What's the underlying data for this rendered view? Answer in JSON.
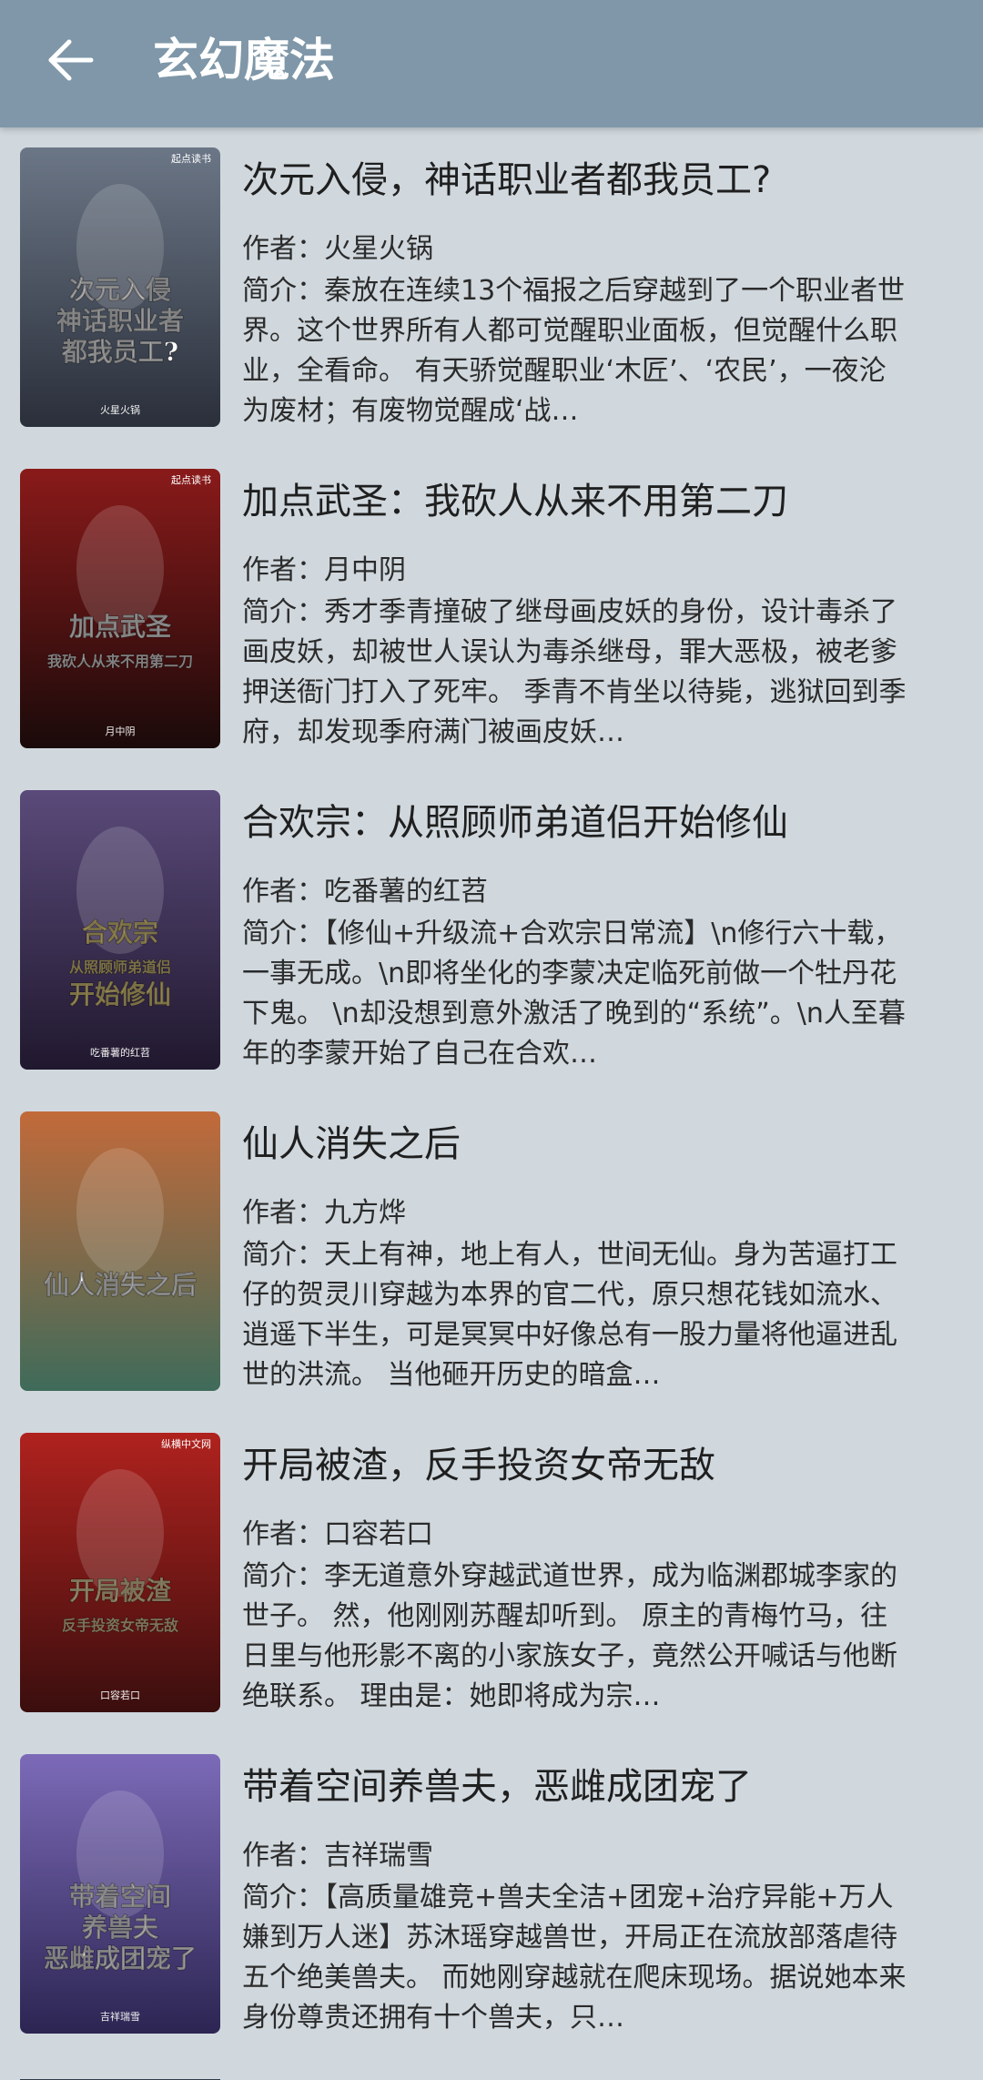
{
  "header": {
    "title": "玄幻魔法",
    "back_icon": "arrow-left-icon"
  },
  "books": [
    {
      "title": "次元入侵，神话职业者都我员工?",
      "author": "作者：火星火锅",
      "intro": "简介：秦放在连续13个福报之后穿越到了一个职业者世界。这个世界所有人都可觉醒职业面板，但觉醒什么职业，全看命。 有天骄觉醒职业‘木匠’、‘农民’，一夜沦为废材；有废物觉醒成‘战…",
      "cover": {
        "c1": "#6b7686",
        "c2": "#2a2f3a",
        "accent": "#ffffff",
        "badge": "起点读书",
        "lines": [
          "次元入侵",
          "神话职业者",
          "都我员工?"
        ],
        "author_mark": "火星火锅"
      }
    },
    {
      "title": "加点武圣：我砍人从来不用第二刀",
      "author": "作者：月中阴",
      "intro": "简介：秀才季青撞破了继母画皮妖的身份，设计毒杀了画皮妖，却被世人误认为毒杀继母，罪大恶极，被老爹押送衙门打入了死牢。 季青不肯坐以待毙，逃狱回到季府，却发现季府满门被画皮妖…",
      "cover": {
        "c1": "#8a1a1a",
        "c2": "#1a0a0a",
        "accent": "#ffffff",
        "badge": "起点读书",
        "lines": [
          "加点武圣",
          "我砍人从来不用第二刀"
        ],
        "author_mark": "月中阴"
      }
    },
    {
      "title": "合欢宗：从照顾师弟道侣开始修仙",
      "author": "作者：吃番薯的红苕",
      "intro": "简介：【修仙+升级流+合欢宗日常流】\\n修行六十载，一事无成。\\n即将坐化的李蒙决定临死前做一个牡丹花下鬼。 \\n却没想到意外激活了晚到的“系统”。\\n人至暮年的李蒙开始了自己在合欢…",
      "cover": {
        "c1": "#5a4a7a",
        "c2": "#20182e",
        "accent": "#f7e08a",
        "badge": "",
        "lines": [
          "合欢宗",
          "从照顾师弟道侣",
          "开始修仙"
        ],
        "author_mark": "吃番薯的红苕"
      }
    },
    {
      "title": "仙人消失之后",
      "author": "作者：九方烨",
      "intro": "简介：天上有神，地上有人，世间无仙。身为苦逼打工仔的贺灵川穿越为本界的官二代，原只想花钱如流水、逍遥下半生，可是冥冥中好像总有一股力量将他逼进乱世的洪流。 当他砸开历史的暗盒…",
      "cover": {
        "c1": "#c26a3a",
        "c2": "#3f6b5a",
        "accent": "#ffffff",
        "badge": "",
        "lines": [
          "仙人消失之后"
        ],
        "author_mark": ""
      }
    },
    {
      "title": "开局被渣，反手投资女帝无敌",
      "author": "作者：口容若口",
      "intro": "简介：李无道意外穿越武道世界，成为临渊郡城李家的世子。 然，他刚刚苏醒却听到。 原主的青梅竹马，往日里与他形影不离的小家族女子，竟然公开喊话与他断绝联系。 理由是：她即将成为宗…",
      "cover": {
        "c1": "#b0221e",
        "c2": "#3a0e0e",
        "accent": "#f7e6b0",
        "badge": "纵横中文网",
        "lines": [
          "开局被渣",
          "反手投资女帝无敌"
        ],
        "author_mark": "口容若口"
      }
    },
    {
      "title": "带着空间养兽夫，恶雌成团宠了",
      "author": "作者：吉祥瑞雪",
      "intro": "简介：【高质量雄竞+兽夫全洁+团宠+治疗异能+万人嫌到万人迷】苏沐瑶穿越兽世，开局正在流放部落虐待五个绝美兽夫。 而她刚穿越就在爬床现场。据说她本来身份尊贵还拥有十个兽夫，只…",
      "cover": {
        "c1": "#7c6ab8",
        "c2": "#2c2552",
        "accent": "#ffffff",
        "badge": "",
        "lines": [
          "带着空间",
          "养兽夫",
          "恶雌成团宠了"
        ],
        "author_mark": "吉祥瑞雪"
      }
    }
  ]
}
